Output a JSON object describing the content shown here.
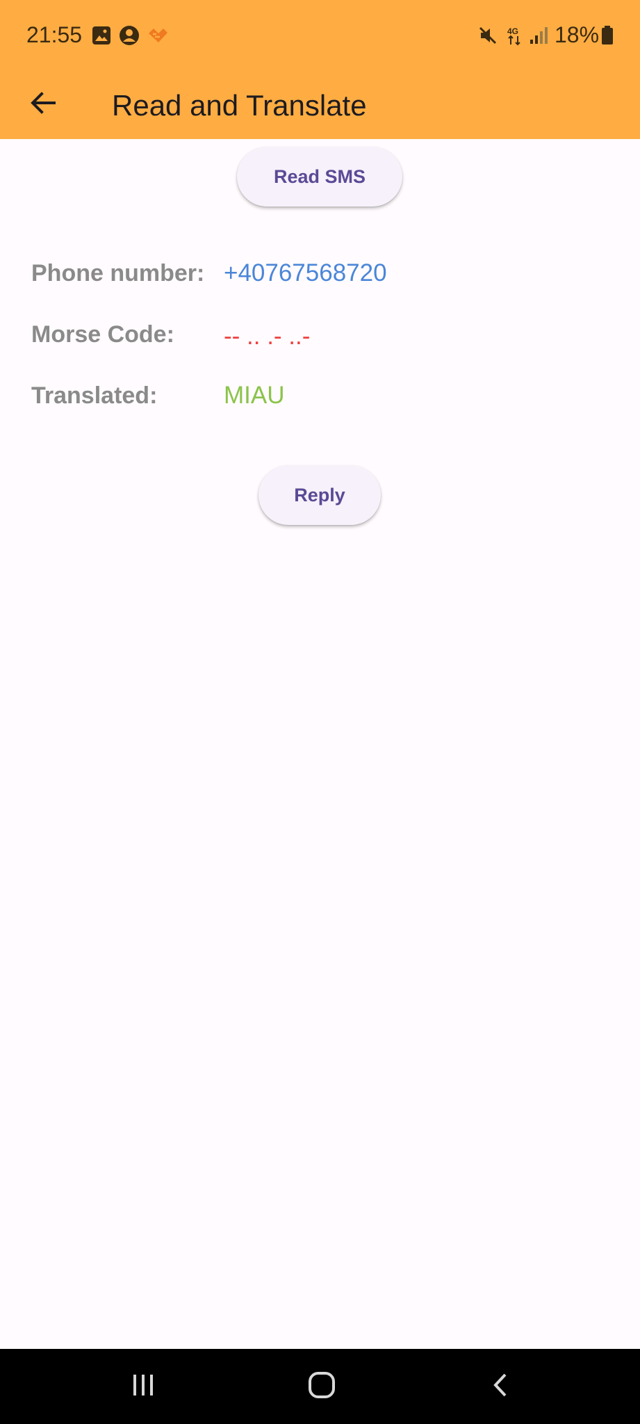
{
  "status_bar": {
    "time": "21:55",
    "battery": "18%",
    "icons": [
      "image-icon",
      "account-circle-icon",
      "app-notification-icon",
      "mute-icon",
      "network-4g-icon",
      "signal-icon",
      "battery-icon"
    ]
  },
  "appbar": {
    "title": "Read and Translate",
    "back_icon": "arrow-back-icon"
  },
  "actions": {
    "read_sms_label": "Read SMS",
    "reply_label": "Reply"
  },
  "fields": {
    "phone": {
      "label": "Phone number:",
      "value": "+40767568720"
    },
    "morse": {
      "label": "Morse Code:",
      "value": "-- .. .- ..-"
    },
    "translated": {
      "label": "Translated:",
      "value": "MIAU"
    }
  },
  "nav_bar": {
    "icons": [
      "recent-apps-icon",
      "home-icon",
      "back-icon"
    ]
  },
  "colors": {
    "appbar": "#ffad42",
    "phone_value": "#4a86d8",
    "morse_value": "#ef3e3e",
    "translated_value": "#8bc34a",
    "label": "#8a8a8a",
    "button_text": "#5a4a96",
    "button_bg": "#f6f1fa"
  }
}
